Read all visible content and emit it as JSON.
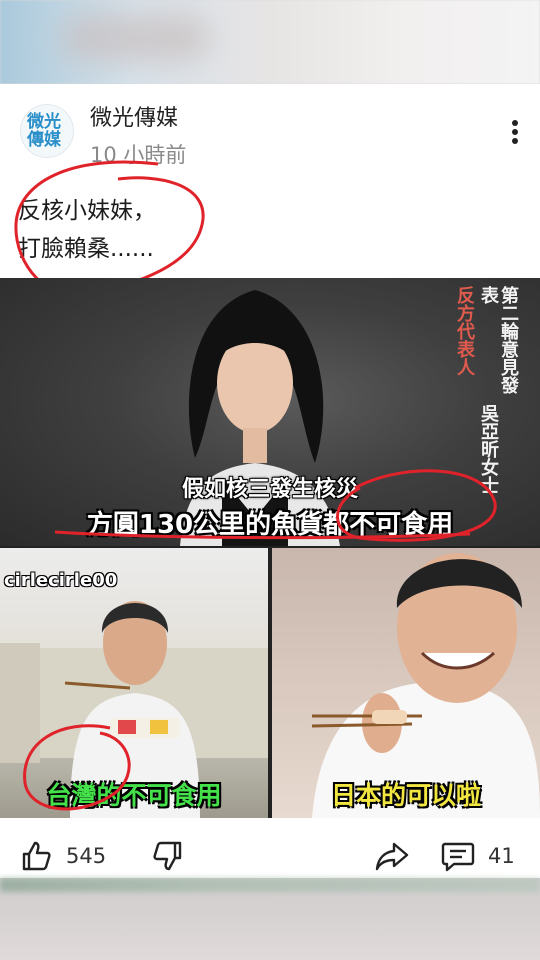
{
  "post": {
    "author": "微光傳媒",
    "avatar_line1": "微光",
    "avatar_line2": "傳媒",
    "time": "10 小時前",
    "text_line1": "反核小妹妹，",
    "text_line2": "打臉賴桑......"
  },
  "video": {
    "top_vertical_red": "反方代表人",
    "top_vertical_white1": "第二輪意見發表",
    "top_vertical_white2": "吳亞昕女士",
    "subtitle_line1": "假如核三發生核災",
    "subtitle_line2": "方圓130公里的魚貨都不可食用",
    "watermark": "cirlecirle00",
    "caption_left": "台灣的不可食用",
    "caption_right": "日本的可以啦"
  },
  "actions": {
    "like_count": "545",
    "comment_count": "41"
  },
  "colors": {
    "annotation_red": "#e0222a",
    "caption_green": "#44e14a",
    "caption_yellow": "#f2e640",
    "vertical_red": "#e05a4d"
  }
}
